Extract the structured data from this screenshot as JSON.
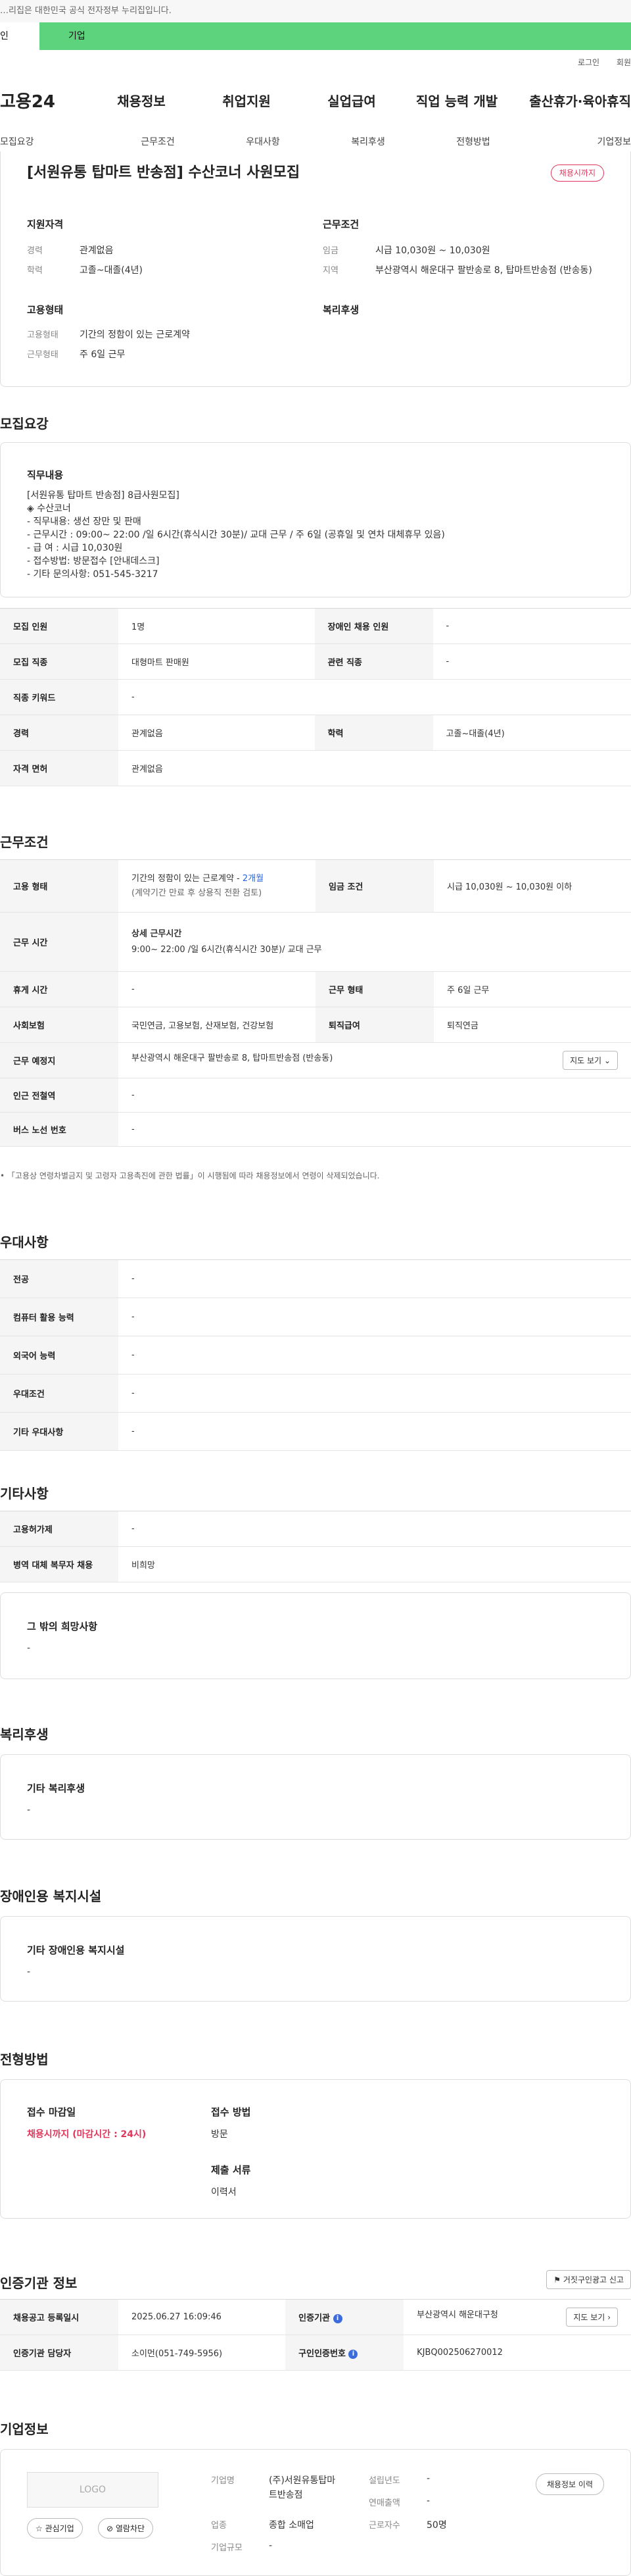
{
  "gov_notice": "…리집은 대한민국 공식 전자정부 누리집입니다.",
  "topbar": {
    "personal": "인",
    "corporate": "기업"
  },
  "toplinks": [
    "로그인",
    "회원"
  ],
  "gnb": {
    "logo": "고용24",
    "items": [
      "채용정보",
      "취업지원",
      "실업급여",
      "직업 능력 개발",
      "출산휴가·육아휴직"
    ]
  },
  "tabs": [
    "모집요강",
    "근무조건",
    "우대사항",
    "복리후생",
    "전형방법",
    "기업정보"
  ],
  "summary": {
    "title": "[서원유통 탑마트 반송점] 수산코너 사원모집",
    "badge": "채용시까지",
    "qual_h": "지원자격",
    "cond_h": "근무조건",
    "career_l": "경력",
    "career_v": "관계없음",
    "edu_l": "학력",
    "edu_v": "고졸~대졸(4년)",
    "wage_l": "임금",
    "wage_v": "시급 10,030원 ~ 10,030원",
    "area_l": "지역",
    "area_v": "부산광역시 해운대구 팔반송로 8, 탑마트반송점 (반송동)",
    "emp_h": "고용형태",
    "welfare_h": "복리후생",
    "type_l": "고용형태",
    "type_v": "기간의 정함이 있는 근로계약",
    "shift_l": "근무형태",
    "shift_v": "주 6일 근무"
  },
  "recruit": {
    "heading": "모집요강",
    "duty_h": "직무내용",
    "duty_lines": [
      "[서원유통 탑마트 반송점] 8급사원모집]",
      "◈ 수산코너",
      "- 직무내용: 생선 장만 및 판매",
      "- 근무시간 :  09:00~ 22:00 /일 6시간(휴식시간 30분)/ 교대 근무 / 주 6일 (공휴일 및 연차 대체휴무 있음)",
      "- 급       여 : 시급 10,030원",
      "- 접수방법: 방문접수 [안내데스크]",
      "- 기타 문의사항: 051-545-3217"
    ],
    "rows": [
      [
        "모집 인원",
        "1명",
        "장애인 채용 인원",
        "-"
      ],
      [
        "모집 직종",
        "대형마트 판매원",
        "관련 직종",
        "-"
      ],
      [
        "직종 키워드",
        "-"
      ],
      [
        "경력",
        "관계없음",
        "학력",
        "고졸~대졸(4년)"
      ],
      [
        "자격 면허",
        "관계없음"
      ]
    ]
  },
  "work": {
    "heading": "근무조건",
    "emp_type_l": "고용 형태",
    "emp_type_v": "기간의 정함이 있는 근로계약 - ",
    "emp_type_months": "2개월",
    "emp_type_note": "(계약기간 만료 후 상용직 전환 검토)",
    "wage_l": "임금 조건",
    "wage_v": "시급 10,030원 ~ 10,030원 이하",
    "hours_l": "근무 시간",
    "hours_h": "상세 근무시간",
    "hours_v": "9:00~ 22:00 /일 6시간(휴식시간 30분)/ 교대 근무",
    "rows": [
      [
        "휴게 시간",
        "-",
        "근무 형태",
        "주 6일 근무"
      ],
      [
        "사회보험",
        "국민연금, 고용보험, 산재보험, 건강보험",
        "퇴직급여",
        "퇴직연금"
      ]
    ],
    "place_l": "근무 예정지",
    "place_v": "부산광역시 해운대구 팔반송로 8, 탑마트반송점 (반송동)",
    "map_btn": "지도 보기",
    "station_l": "인근 전철역",
    "station_v": "-",
    "bus_l": "버스 노선 번호",
    "bus_v": "-",
    "footnote": "「고용상 연령차별금지 및 고령자 고용촉진에 관한 법률」이 시행됨에 따라 채용정보에서 연령이 삭제되었습니다."
  },
  "pref": {
    "heading": "우대사항",
    "rows": [
      [
        "전공",
        "-"
      ],
      [
        "컴퓨터 활용 능력",
        "-"
      ],
      [
        "외국어 능력",
        "-"
      ],
      [
        "우대조건",
        "-"
      ],
      [
        "기타 우대사항",
        "-"
      ]
    ]
  },
  "etc": {
    "heading": "기타사항",
    "rows": [
      [
        "고용허가제",
        "-"
      ],
      [
        "병역 대체 복무자 채용",
        "비희망"
      ]
    ],
    "wish_h": "그 밖의 희망사항",
    "wish_v": "-"
  },
  "welfare": {
    "heading": "복리후생",
    "box_h": "기타 복리후생",
    "box_v": "-"
  },
  "disabled": {
    "heading": "장애인용 복지시설",
    "box_h": "기타 장애인용 복지시설",
    "box_v": "-"
  },
  "process": {
    "heading": "전형방법",
    "deadline_h": "접수 마감일",
    "deadline_v": "채용시까지 (마감시간 : 24시)",
    "method_h": "접수 방법",
    "method_v": "방문",
    "docs_h": "제출 서류",
    "docs_v": "이력서"
  },
  "cert": {
    "heading": "인증기관 정보",
    "report_btn": "거짓구인광고 신고",
    "reg_l": "채용공고 등록일시",
    "reg_v": "2025.06.27 16:09:46",
    "agency_l": "인증기관",
    "agency_v": "부산광역시 해운대구청",
    "map_btn": "지도 보기",
    "manager_l": "인증기관 담당자",
    "manager_v": "소이먼(051-749-5956)",
    "id_l": "구인인증번호",
    "id_v": "KJBQ002506270012"
  },
  "company": {
    "heading": "기업정보",
    "logo": "LOGO",
    "fav_btn": "관심기업",
    "block_btn": "열람차단",
    "name_l": "기업명",
    "name_v": "(주)서원유통탑마트반송점",
    "year_l": "설립년도",
    "year_v": "-",
    "sales_l": "연매출액",
    "sales_v": "-",
    "ind_l": "업종",
    "ind_v": "종합 소매업",
    "emp_l": "근로자수",
    "emp_v": "50명",
    "size_l": "기업규모",
    "size_v": "-",
    "history_btn": "채용정보 이력"
  }
}
